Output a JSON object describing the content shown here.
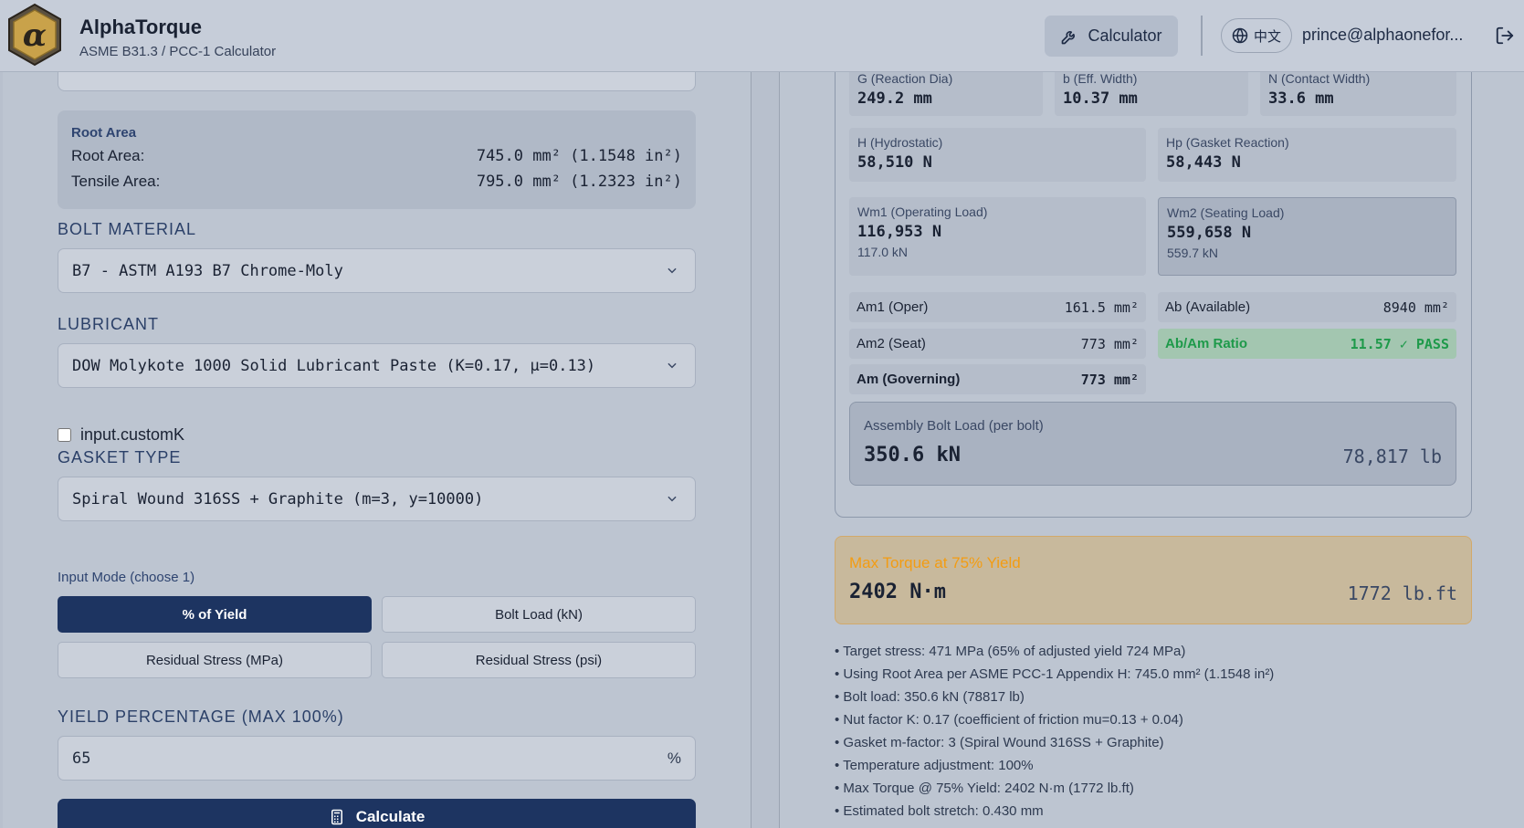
{
  "header": {
    "brand_title": "AlphaTorque",
    "brand_subtitle": "ASME B31.3 / PCC-1 Calculator",
    "calculator_label": "Calculator",
    "language_label": "中文",
    "user_email": "prince@alphaonefor..."
  },
  "left": {
    "root_area": {
      "title": "Root Area",
      "root_label": "Root Area:",
      "root_value": "745.0 mm² (1.1548 in²)",
      "tensile_label": "Tensile Area:",
      "tensile_value": "795.0 mm² (1.2323 in²)"
    },
    "bolt_material": {
      "label": "BOLT MATERIAL",
      "value": "B7 - ASTM A193 B7 Chrome-Moly"
    },
    "lubricant": {
      "label": "LUBRICANT",
      "value": "DOW Molykote 1000 Solid Lubricant Paste (K=0.17, μ=0.13)"
    },
    "custom_k_label": "input.customK",
    "gasket": {
      "label": "GASKET TYPE",
      "value": "Spiral Wound 316SS + Graphite (m=3, y=10000)"
    },
    "input_mode": {
      "label": "Input Mode (choose 1)",
      "options": [
        "% of Yield",
        "Bolt Load (kN)",
        "Residual Stress (MPa)",
        "Residual Stress (psi)"
      ],
      "selected": "% of Yield"
    },
    "yield_percentage": {
      "label": "YIELD PERCENTAGE (MAX 100%)",
      "value": "65",
      "unit": "%"
    },
    "calculate_label": "Calculate"
  },
  "right": {
    "gasket_dims": [
      {
        "label": "G (Reaction Dia)",
        "value": "249.2 mm"
      },
      {
        "label": "b (Eff. Width)",
        "value": "10.37 mm"
      },
      {
        "label": "N (Contact Width)",
        "value": "33.6 mm"
      }
    ],
    "h_loads": [
      {
        "label": "H (Hydrostatic)",
        "value": "58,510 N"
      },
      {
        "label": "Hp (Gasket Reaction)",
        "value": "58,443 N"
      }
    ],
    "wm": [
      {
        "label": "Wm1 (Operating Load)",
        "value": "116,953 N",
        "sub": "117.0 kN"
      },
      {
        "label": "Wm2 (Seating Load)",
        "value": "559,658 N",
        "sub": "559.7 kN"
      }
    ],
    "areas": {
      "am1_label": "Am1 (Oper)",
      "am1_value": "161.5 mm²",
      "ab_label": "Ab (Available)",
      "ab_value": "8940 mm²",
      "am2_label": "Am2 (Seat)",
      "am2_value": "773 mm²",
      "ratio_label": "Ab/Am Ratio",
      "ratio_value": "11.57 ✓ PASS",
      "am_label": "Am (Governing)",
      "am_value": "773 mm²"
    },
    "assembly": {
      "label": "Assembly Bolt Load (per bolt)",
      "value_kn": "350.6 kN",
      "value_lb": "78,817 lb"
    },
    "max_torque": {
      "label": "Max Torque at 75% Yield",
      "value_nm": "2402 N·m",
      "value_lbft": "1772 lb.ft"
    },
    "notes": [
      "Target stress: 471 MPa (65% of adjusted yield 724 MPa)",
      "Using Root Area per ASME PCC-1 Appendix H: 745.0 mm² (1.1548 in²)",
      "Bolt load: 350.6 kN (78817 lb)",
      "Nut factor K: 0.17 (coefficient of friction mu=0.13 + 0.04)",
      "Gasket m-factor: 3 (Spiral Wound 316SS + Graphite)",
      "Temperature adjustment: 100%",
      "Max Torque @ 75% Yield: 2402 N·m (1772 lb.ft)",
      "Estimated bolt stretch: 0.430 mm"
    ]
  },
  "colors": {
    "primary": "#1d3461",
    "pass_green": "#1e9a4a",
    "torque_orange": "#f39c12"
  }
}
